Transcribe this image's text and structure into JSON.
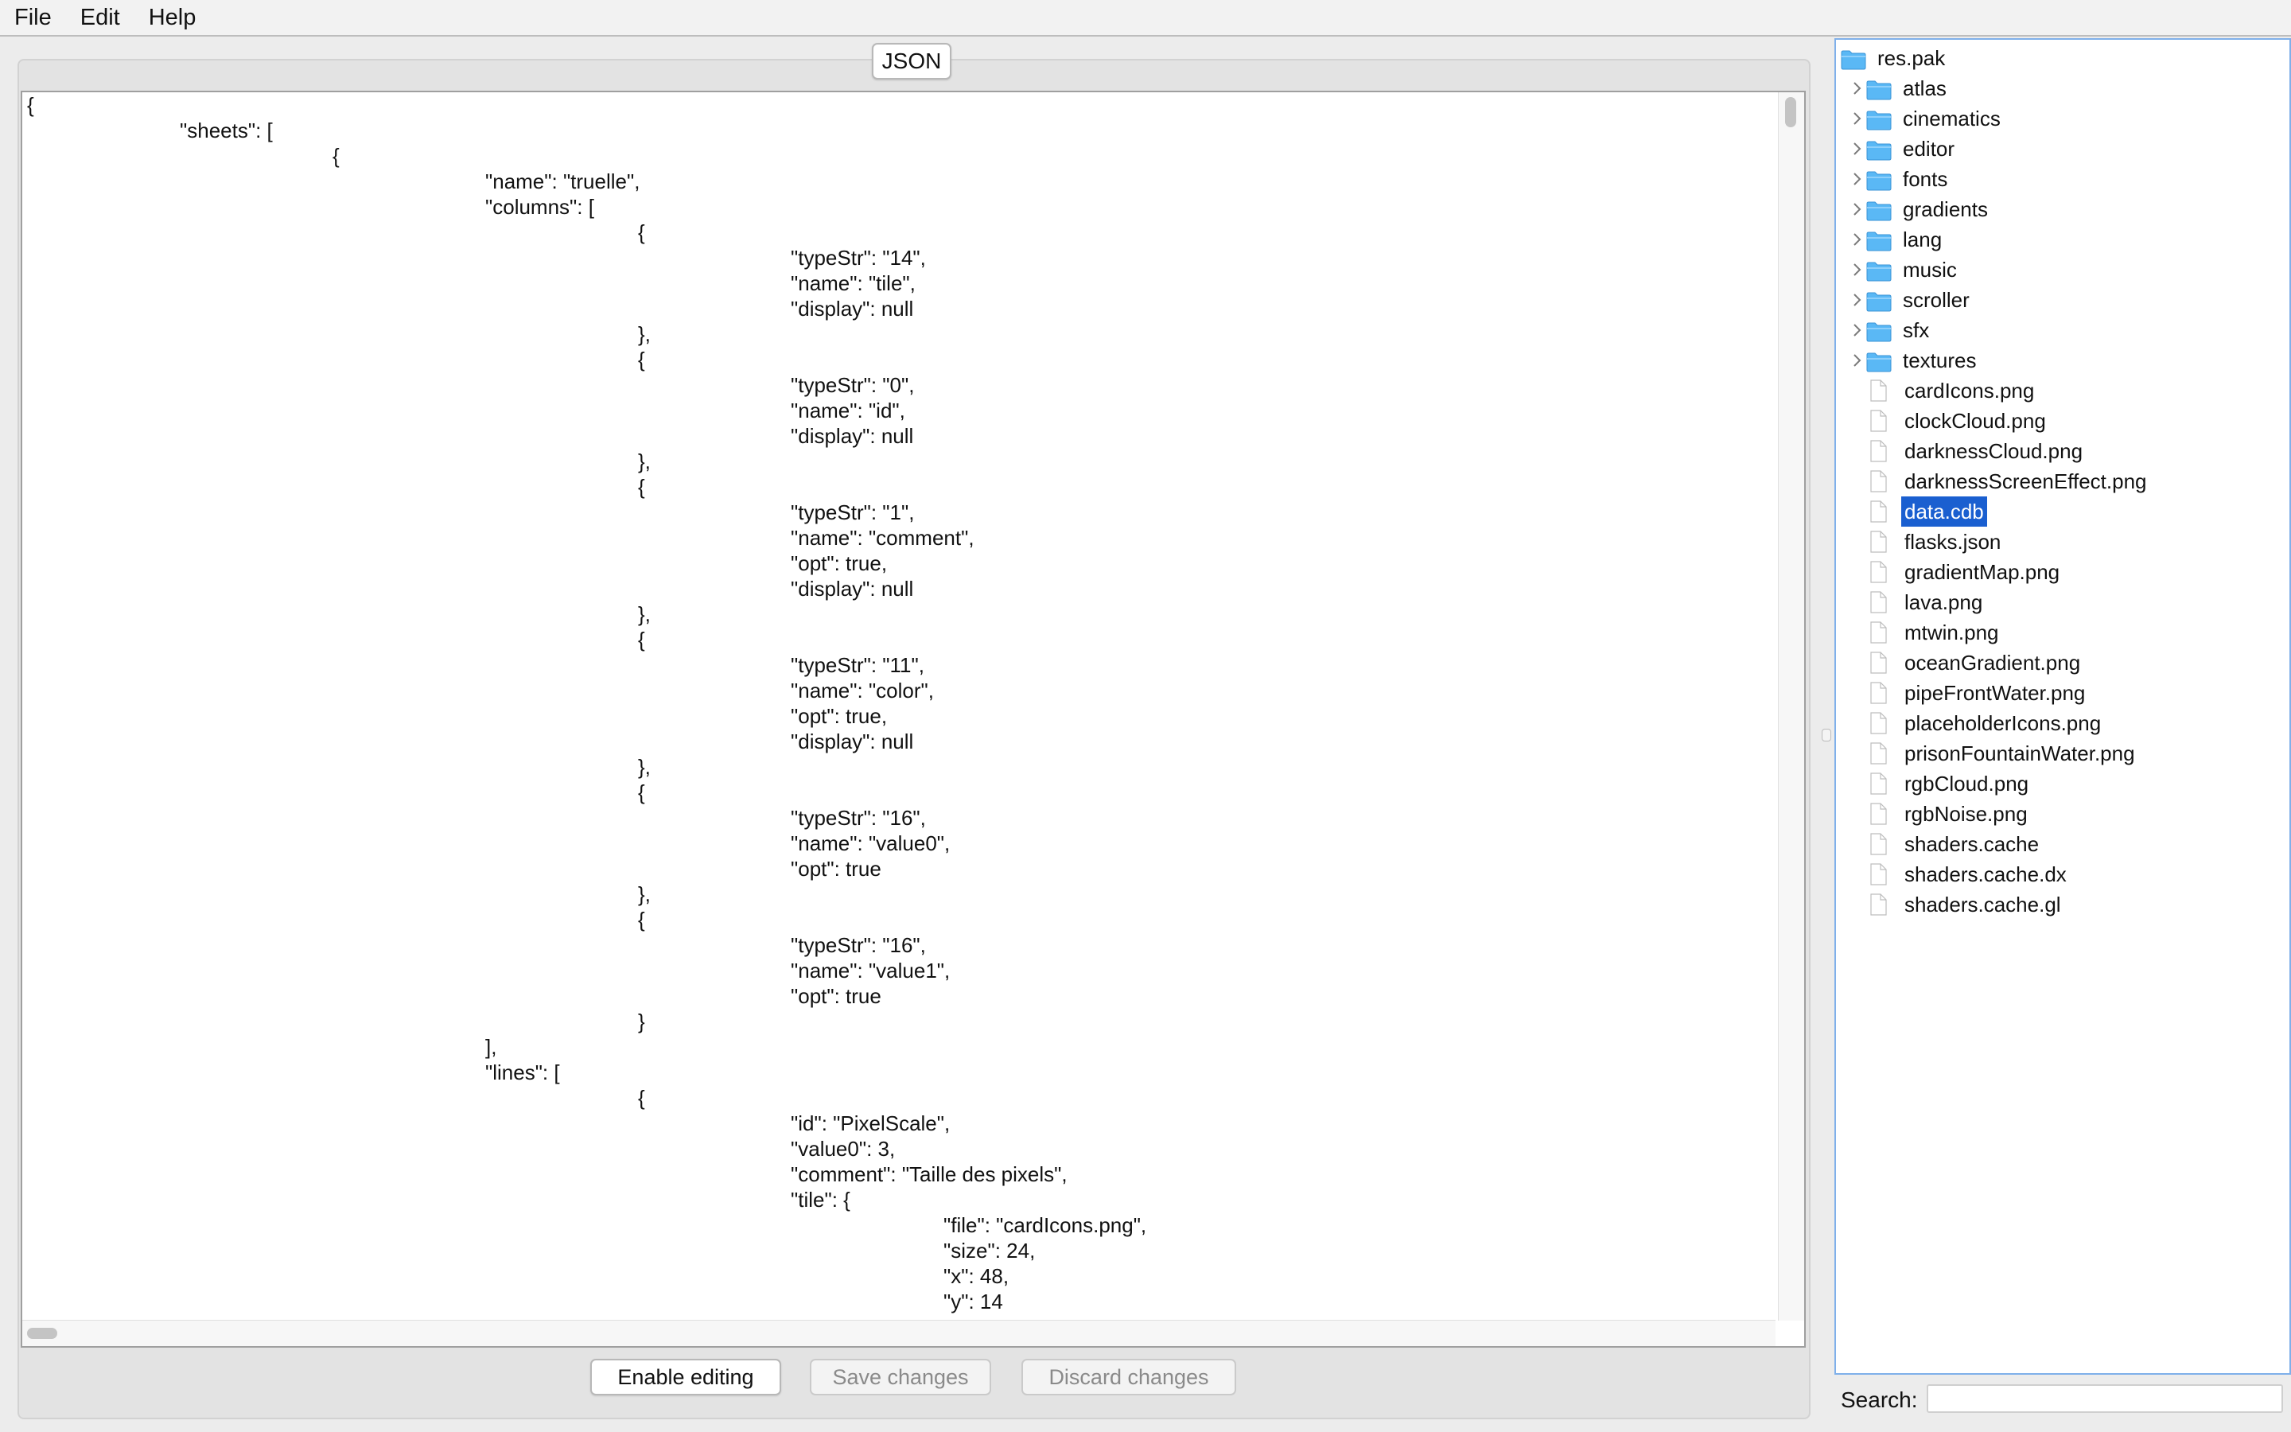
{
  "menu": [
    "File",
    "Edit",
    "Help"
  ],
  "editor": {
    "tab_label": "JSON",
    "lines": [
      "{",
      "\"sheets\": [",
      "{",
      "\"name\": \"truelle\",",
      "\"columns\": [",
      "{",
      "\"typeStr\": \"14\",",
      "\"name\": \"tile\",",
      "\"display\": null",
      "},",
      "{",
      "\"typeStr\": \"0\",",
      "\"name\": \"id\",",
      "\"display\": null",
      "},",
      "{",
      "\"typeStr\": \"1\",",
      "\"name\": \"comment\",",
      "\"opt\": true,",
      "\"display\": null",
      "},",
      "{",
      "\"typeStr\": \"11\",",
      "\"name\": \"color\",",
      "\"opt\": true,",
      "\"display\": null",
      "},",
      "{",
      "\"typeStr\": \"16\",",
      "\"name\": \"value0\",",
      "\"opt\": true",
      "},",
      "{",
      "\"typeStr\": \"16\",",
      "\"name\": \"value1\",",
      "\"opt\": true",
      "}",
      "],",
      "\"lines\": [",
      "{",
      "\"id\": \"PixelScale\",",
      "\"value0\": 3,",
      "\"comment\": \"Taille des pixels\",",
      "\"tile\": {",
      "\"file\": \"cardIcons.png\",",
      "\"size\": 24,",
      "\"x\": 48,",
      "\"y\": 14"
    ]
  },
  "buttons": {
    "enable": "Enable editing",
    "save": "Save changes",
    "discard": "Discard changes"
  },
  "tree": {
    "root": "res.pak",
    "folders": [
      "atlas",
      "cinematics",
      "editor",
      "fonts",
      "gradients",
      "lang",
      "music",
      "scroller",
      "sfx",
      "textures"
    ],
    "files": [
      "cardIcons.png",
      "clockCloud.png",
      "darknessCloud.png",
      "darknessScreenEffect.png",
      "data.cdb",
      "flasks.json",
      "gradientMap.png",
      "lava.png",
      "mtwin.png",
      "oceanGradient.png",
      "pipeFrontWater.png",
      "placeholderIcons.png",
      "prisonFountainWater.png",
      "rgbCloud.png",
      "rgbNoise.png",
      "shaders.cache",
      "shaders.cache.dx",
      "shaders.cache.gl"
    ],
    "selected": "data.cdb"
  },
  "search": {
    "label": "Search:",
    "value": ""
  },
  "colors": {
    "selection": "#1a5fd0",
    "folder": "#5ab8f5"
  }
}
